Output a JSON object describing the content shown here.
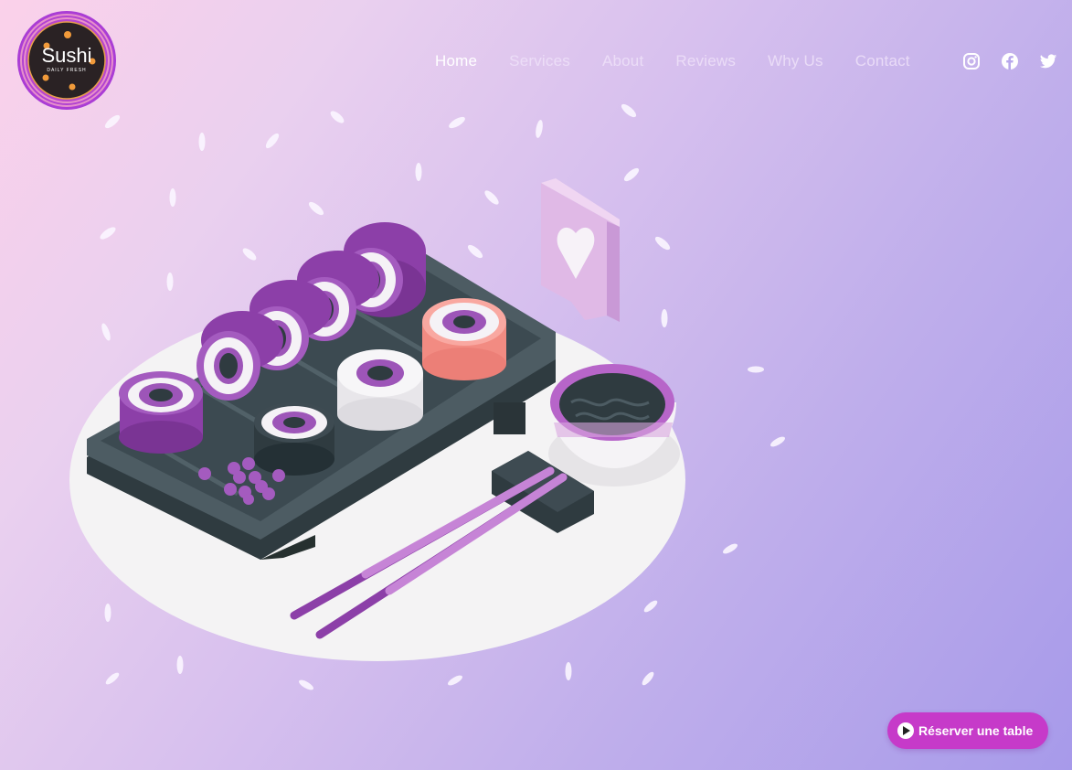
{
  "logo": {
    "title": "Sushi",
    "tagline": "DAILY FRESH"
  },
  "nav": {
    "items": [
      {
        "label": "Home"
      },
      {
        "label": "Services"
      },
      {
        "label": "About"
      },
      {
        "label": "Reviews"
      },
      {
        "label": "Why Us"
      },
      {
        "label": "Contact"
      }
    ]
  },
  "social": {
    "icons": [
      "instagram-icon",
      "facebook-icon",
      "twitter-icon"
    ]
  },
  "cta": {
    "label": "Réserver une table"
  },
  "colors": {
    "accent": "#c63ac9",
    "sushi_purple": "#a45bbf",
    "tray": "#3e4b52",
    "salmon": "#f28b82"
  }
}
